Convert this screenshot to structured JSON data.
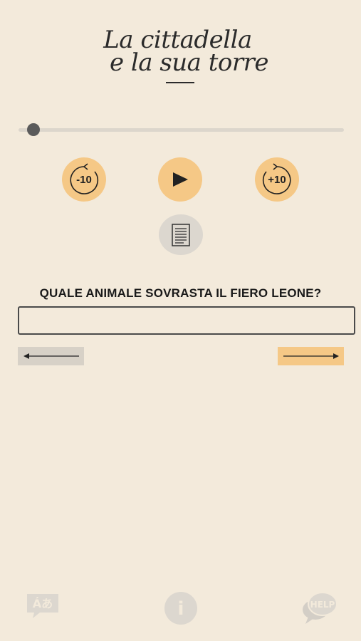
{
  "title": {
    "line1": "La cittadella",
    "line2": "e la sua torre"
  },
  "player": {
    "progress": 0.03,
    "rewind_label": "-10",
    "forward_label": "+10",
    "play_icon": "play-icon",
    "transcript_icon": "document-icon"
  },
  "quiz": {
    "question": "QUALE ANIMALE SOVRASTA IL FIERO LEONE?",
    "answer_value": "",
    "prev_icon": "arrow-left-icon",
    "next_icon": "arrow-right-icon"
  },
  "footer": {
    "language_icon_text": "Áあ",
    "info_icon_text": "i",
    "help_icon_text": "HELP"
  },
  "colors": {
    "background": "#f3eadb",
    "accent": "#f5c886",
    "muted": "#dcd7cf"
  }
}
